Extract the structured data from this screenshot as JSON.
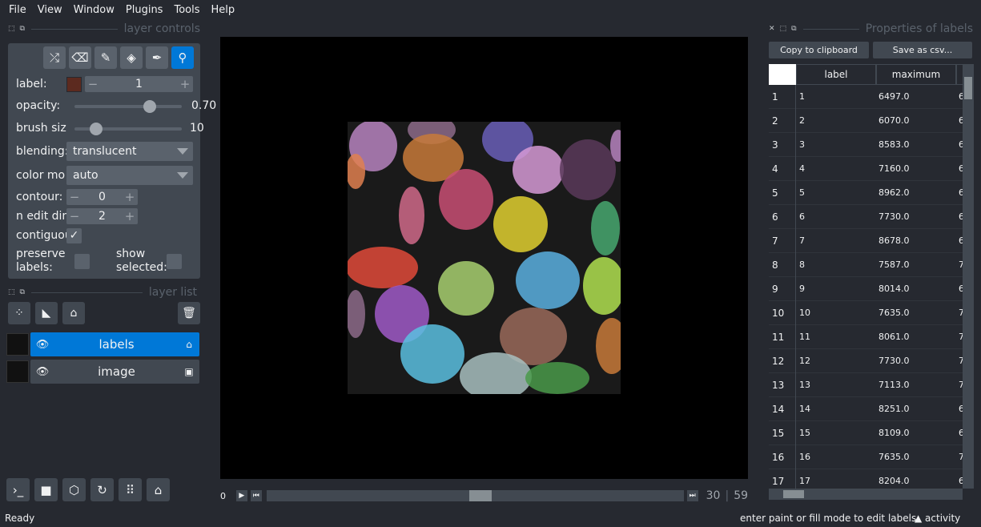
{
  "menu": [
    "File",
    "View",
    "Window",
    "Plugins",
    "Tools",
    "Help"
  ],
  "layer_controls": {
    "title": "layer controls",
    "tools": [
      {
        "icon": "shuffle-icon",
        "glyph": "⤮",
        "active": false
      },
      {
        "icon": "eraser-icon",
        "glyph": "⌫",
        "active": false
      },
      {
        "icon": "brush-icon",
        "glyph": "✎",
        "active": false
      },
      {
        "icon": "fill-bucket-icon",
        "glyph": "◈",
        "active": false
      },
      {
        "icon": "color-picker-icon",
        "glyph": "✒",
        "active": false
      },
      {
        "icon": "zoom-pan-icon",
        "glyph": "⚲",
        "active": true
      }
    ],
    "label_label": "label:",
    "label_value": "1",
    "label_color": "#5c2a1f",
    "opacity_label": "opacity:",
    "opacity_value": "0.70",
    "opacity_fraction": 0.7,
    "brush_label": "brush siz",
    "brush_value": "10",
    "brush_fraction": 0.2,
    "blending_label": "blending:",
    "blending_value": "translucent",
    "colormode_label": "color mo",
    "colormode_value": "auto",
    "contour_label": "contour:",
    "contour_value": "0",
    "ndim_label": "n edit dim",
    "ndim_value": "2",
    "contiguous_label": "contiguou",
    "contiguous_checked": "✓",
    "preserve_label_1": "preserve",
    "preserve_label_2": "labels:",
    "show_selected_1": "show",
    "show_selected_2": "selected:"
  },
  "layer_list": {
    "title": "layer list",
    "layers": [
      {
        "name": "labels",
        "selected": true
      },
      {
        "name": "image",
        "selected": false
      }
    ]
  },
  "dims": {
    "start": "0",
    "current": "30",
    "total": "59"
  },
  "status": {
    "left": "Ready",
    "hint": "enter paint or fill mode to edit labels",
    "activity": "activity"
  },
  "properties": {
    "title": "Properties of labels",
    "copy_button": "Copy to clipboard",
    "save_button": "Save as csv...",
    "columns": [
      "label",
      "maximum"
    ],
    "rows": [
      {
        "idx": "1",
        "label": "1",
        "maximum": "6497.0",
        "extra": "6"
      },
      {
        "idx": "2",
        "label": "2",
        "maximum": "6070.0",
        "extra": "6"
      },
      {
        "idx": "3",
        "label": "3",
        "maximum": "8583.0",
        "extra": "6"
      },
      {
        "idx": "4",
        "label": "4",
        "maximum": "7160.0",
        "extra": "6"
      },
      {
        "idx": "5",
        "label": "5",
        "maximum": "8962.0",
        "extra": "6"
      },
      {
        "idx": "6",
        "label": "6",
        "maximum": "7730.0",
        "extra": "6"
      },
      {
        "idx": "7",
        "label": "7",
        "maximum": "8678.0",
        "extra": "6"
      },
      {
        "idx": "8",
        "label": "8",
        "maximum": "7587.0",
        "extra": "7"
      },
      {
        "idx": "9",
        "label": "9",
        "maximum": "8014.0",
        "extra": "6"
      },
      {
        "idx": "10",
        "label": "10",
        "maximum": "7635.0",
        "extra": "7"
      },
      {
        "idx": "11",
        "label": "11",
        "maximum": "8061.0",
        "extra": "7"
      },
      {
        "idx": "12",
        "label": "12",
        "maximum": "7730.0",
        "extra": "7"
      },
      {
        "idx": "13",
        "label": "13",
        "maximum": "7113.0",
        "extra": "7"
      },
      {
        "idx": "14",
        "label": "14",
        "maximum": "8251.0",
        "extra": "6"
      },
      {
        "idx": "15",
        "label": "15",
        "maximum": "8109.0",
        "extra": "6"
      },
      {
        "idx": "16",
        "label": "16",
        "maximum": "7635.0",
        "extra": "7"
      },
      {
        "idx": "17",
        "label": "17",
        "maximum": "8204.0",
        "extra": "6"
      }
    ]
  },
  "cell_colors": [
    "#b784c0",
    "#8d6b8a",
    "#c87a3a",
    "#6a5fb9",
    "#d69ad6",
    "#5a3a5a",
    "#c94f74",
    "#d06a8a",
    "#e0d030",
    "#48a870",
    "#e04a3a",
    "#a8d070",
    "#5ab0e0",
    "#b0e050",
    "#a05ac8",
    "#9a6a5a",
    "#5ac0e0",
    "#a8c0c0",
    "#4a9a4a",
    "#e08050"
  ]
}
